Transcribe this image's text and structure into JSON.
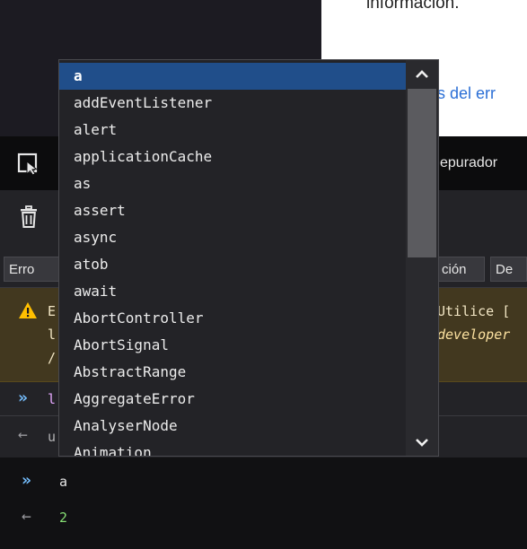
{
  "page": {
    "top_text": "información.",
    "link_text": "s del err"
  },
  "toolbar": {
    "debugger_tab": "epurador"
  },
  "filters": [
    {
      "label": "Erro"
    },
    {
      "label": "ción"
    },
    {
      "label": "De"
    }
  ],
  "warning": {
    "line1_left": "E",
    "line1_right": "Utilice [",
    "line2_left": "l",
    "line2_right": "developer",
    "line3_left": "/"
  },
  "history": {
    "prompt_glyph": "»",
    "cmd_fragment": "l",
    "output_glyph": "←",
    "output_fragment": "u"
  },
  "input": {
    "prompt_glyph": "»",
    "command": "a",
    "result_glyph": "←",
    "result": "2"
  },
  "autocomplete": {
    "items": [
      "a",
      "addEventListener",
      "alert",
      "applicationCache",
      "as",
      "assert",
      "async",
      "atob",
      "await",
      "AbortController",
      "AbortSignal",
      "AbstractRange",
      "AggregateError",
      "AnalyserNode",
      "Animation"
    ],
    "selected_index": 0,
    "scroll_position": 0.0
  },
  "colors": {
    "selection": "#204e8a",
    "prompt": "#75bfff",
    "result_number": "#86de74",
    "warning_bg": "#42381f",
    "warning_icon": "#ffbf00"
  }
}
